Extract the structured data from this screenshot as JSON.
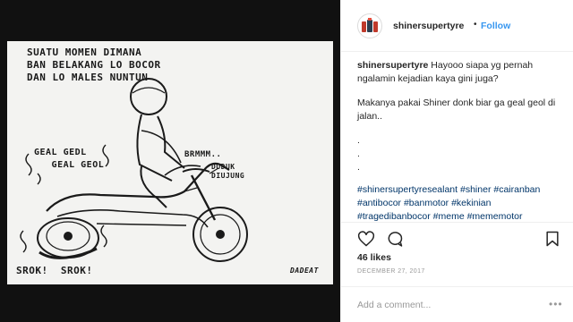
{
  "post": {
    "username": "shinersupertyre",
    "follow_label": "Follow",
    "header_dot": "•",
    "caption_user": "shinersupertyre",
    "caption_text": "Hayooo siapa yg pernah ngalamin kejadian kaya gini juga?",
    "caption_p2": "Makanya pakai Shiner donk biar ga geal geol di jalan..",
    "dots": [
      ".",
      ".",
      "."
    ],
    "hashtags": [
      "#shinersupertyresealant",
      "#shiner",
      "#cairanban",
      "#antibocor",
      "#banmotor",
      "#kekinian",
      "#tragedibanbocor",
      "#meme",
      "#mememotor"
    ],
    "likes": "46 likes",
    "date": "DECEMBER 27, 2017",
    "comment_placeholder": "Add a comment...",
    "more_glyph": "•••"
  },
  "comic": {
    "caption": "SUATU MOMEN DIMANA\nBAN BELAKANG LO BOCOR\nDAN LO MALES NUNTUN",
    "geal_geol": "GEAL GEDL\n   GEAL GEOL",
    "brmm": "BRMMM..",
    "duduk": "DUDUK\nDIUJUNG",
    "srok": "SROK!  SROK!",
    "signature": "DADEAT"
  },
  "icons": {
    "like": "heart-icon",
    "comment": "comment-icon",
    "share": "share-icon",
    "save": "bookmark-icon"
  },
  "colors": {
    "link_blue": "#3897f0",
    "hashtag_blue": "#003569",
    "text": "#262626",
    "muted": "#999999",
    "media_bg": "#111111"
  }
}
